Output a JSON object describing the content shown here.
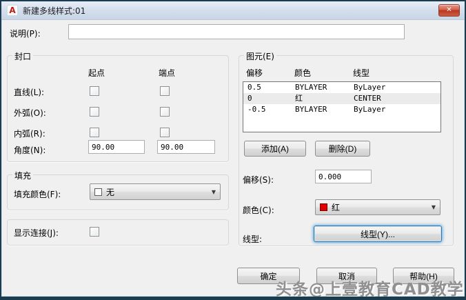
{
  "window": {
    "title": "新建多线样式:01"
  },
  "icons": {
    "app_glyph": "A",
    "close_glyph": "✕",
    "dropdown_arrow": "▼"
  },
  "description": {
    "label": "说明(P):",
    "value": ""
  },
  "caps": {
    "title": "封口",
    "col_start": "起点",
    "col_end": "端点",
    "rows": [
      {
        "label": "直线(L):",
        "start_checked": false,
        "end_checked": false
      },
      {
        "label": "外弧(O):",
        "start_checked": false,
        "end_checked": false
      },
      {
        "label": "内弧(R):",
        "start_checked": false,
        "end_checked": false
      }
    ],
    "angle_label": "角度(N):",
    "angle_start": "90.00",
    "angle_end": "90.00"
  },
  "fill": {
    "title": "填充",
    "color_label": "填充颜色(F):",
    "color_value": "无",
    "none_swatch_color": "#ffffff"
  },
  "joints": {
    "label": "显示连接(J):",
    "checked": false
  },
  "elements": {
    "title": "图元(E)",
    "columns": [
      "偏移",
      "颜色",
      "线型"
    ],
    "rows": [
      {
        "offset": "0.5",
        "color": "BYLAYER",
        "linetype": "ByLayer",
        "selected": false
      },
      {
        "offset": "0",
        "color": "红",
        "linetype": "CENTER",
        "selected": true
      },
      {
        "offset": "-0.5",
        "color": "BYLAYER",
        "linetype": "ByLayer",
        "selected": false
      }
    ],
    "add_button": "添加(A)",
    "delete_button": "删除(D)",
    "offset_label": "偏移(S):",
    "offset_value": "0.000",
    "color_label": "颜色(C):",
    "color_value": "红",
    "color_swatch": "#e10000",
    "linetype_label": "线型:",
    "linetype_button": "线型(Y)..."
  },
  "footer": {
    "ok": "确定",
    "cancel": "取消",
    "help": "帮助(H)"
  },
  "watermark": {
    "text": "头条@上壹教育CAD教学"
  }
}
